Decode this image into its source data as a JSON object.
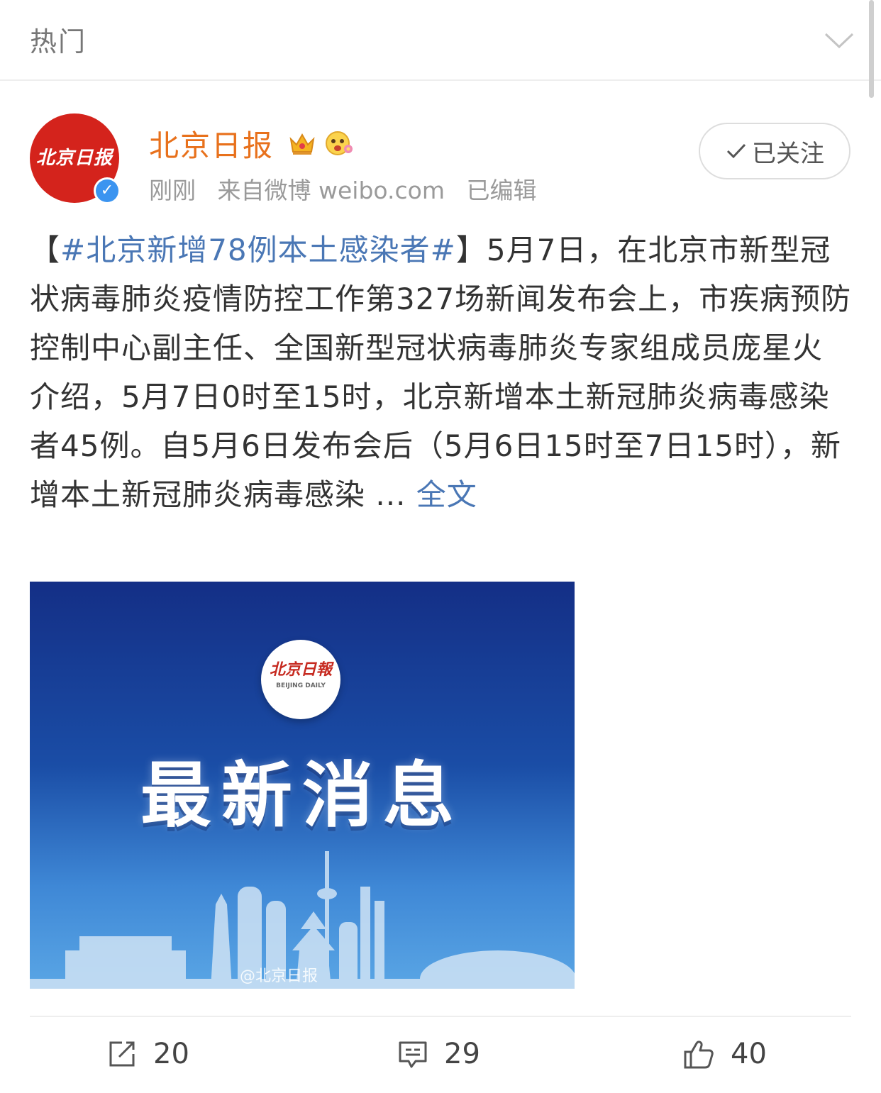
{
  "header": {
    "title": "热门"
  },
  "post": {
    "avatar_text": "北京日报",
    "username": "北京日报",
    "meta": {
      "time": "刚刚",
      "source": "来自微博 weibo.com",
      "edited": "已编辑"
    },
    "follow_label": "已关注",
    "text": {
      "bracket_open": "【",
      "topic": "#北京新增78例本土感染者#",
      "bracket_close": "】",
      "body": "5月7日，在北京市新型冠状病毒肺炎疫情防控工作第327场新闻发布会上，市疾病预防控制中心副主任、全国新型冠状病毒肺炎专家组成员庞星火介绍，5月7日0时至15时，北京新增本土新冠肺炎病毒感染者45例。自5月6日发布会后（5月6日15时至7日15时），新增本土新冠肺炎病毒感染 ... ",
      "fulltext_label": "全文"
    },
    "image": {
      "logo_cn": "北京日報",
      "logo_en": "BEIJING DAILY",
      "title": "最新消息",
      "watermark": "@北京日报"
    },
    "actions": {
      "repost_count": "20",
      "comment_count": "29",
      "like_count": "40"
    }
  },
  "colors": {
    "brand_red": "#d4231c",
    "username_orange": "#e8711c",
    "link_blue": "#4a77b5",
    "verified_blue": "#3b94f0"
  }
}
